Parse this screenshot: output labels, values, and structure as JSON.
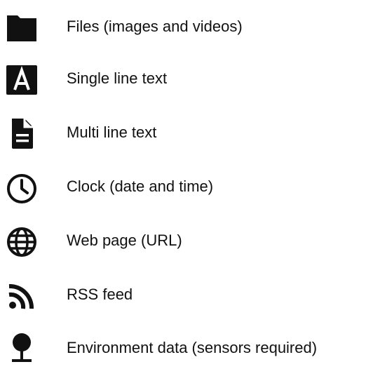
{
  "items": [
    {
      "icon": "folder-icon",
      "label": "Files (images and videos)"
    },
    {
      "icon": "letter-a-icon",
      "label": "Single line text"
    },
    {
      "icon": "document-icon",
      "label": "Multi line text"
    },
    {
      "icon": "clock-icon",
      "label": "Clock (date and time)"
    },
    {
      "icon": "globe-icon",
      "label": "Web page (URL)"
    },
    {
      "icon": "rss-icon",
      "label": "RSS feed"
    },
    {
      "icon": "sensor-pin-icon",
      "label": "Environment data (sensors required)"
    }
  ]
}
